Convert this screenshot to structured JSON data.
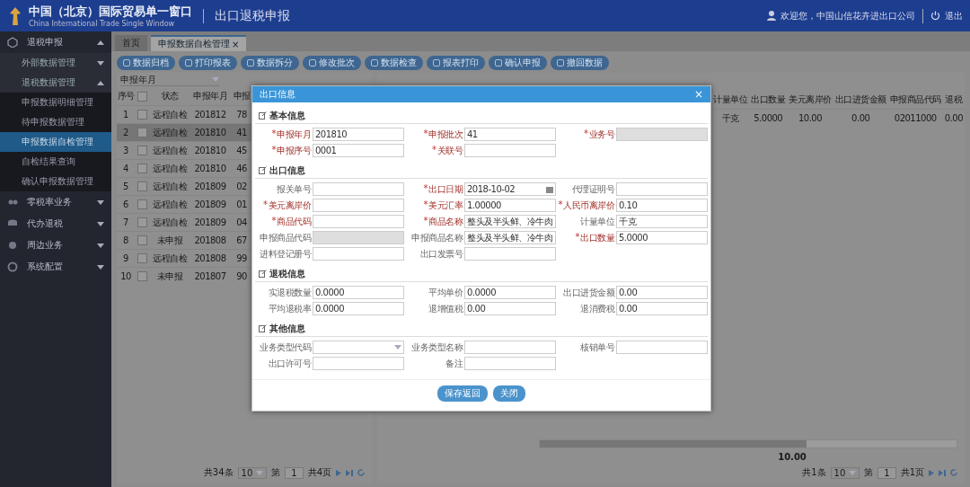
{
  "header": {
    "title": "中国（北京）国际贸易单一窗口",
    "subtitle": "China International Trade Single Window",
    "module": "出口退税申报",
    "welcome": "欢迎您，中国山信花卉进出口公司",
    "logout": "退出"
  },
  "sidebar": {
    "items": [
      {
        "label": "退税申报",
        "expanded": true,
        "children": [
          {
            "label": "外部数据管理",
            "expanded": false
          },
          {
            "label": "退税数据管理",
            "expanded": true,
            "children": [
              {
                "label": "申报数据明细管理",
                "selected": false
              },
              {
                "label": "待申报数据管理",
                "selected": false
              },
              {
                "label": "申报数据自检管理",
                "selected": true
              },
              {
                "label": "自检结果查询",
                "selected": false
              },
              {
                "label": "确认申报数据管理",
                "selected": false
              }
            ]
          }
        ]
      },
      {
        "label": "零税率业务",
        "expanded": false
      },
      {
        "label": "代办退税",
        "expanded": false
      },
      {
        "label": "周边业务",
        "expanded": false
      },
      {
        "label": "系统配置",
        "expanded": false
      }
    ]
  },
  "tabs": [
    {
      "label": "首页",
      "selected": false
    },
    {
      "label": "申报数据自检管理",
      "selected": true,
      "close": "×"
    }
  ],
  "toolbar": [
    "数据归档",
    "打印报表",
    "数据拆分",
    "修改批次",
    "数据检查",
    "报表打印",
    "确认申报",
    "撤回数据"
  ],
  "filter": {
    "placeholder": "申报年月"
  },
  "left_table": {
    "columns": [
      "序号",
      "状态",
      "申报年月",
      "申报"
    ],
    "header_checked": false,
    "rows": [
      {
        "index": "1",
        "checked": false,
        "selected": false,
        "status": "远程自检",
        "year_month": "201812",
        "batch": "78"
      },
      {
        "index": "2",
        "checked": false,
        "selected": true,
        "status": "远程自检",
        "year_month": "201810",
        "batch": "41"
      },
      {
        "index": "3",
        "checked": false,
        "selected": false,
        "status": "远程自检",
        "year_month": "201810",
        "batch": "45"
      },
      {
        "index": "4",
        "checked": false,
        "selected": false,
        "status": "远程自检",
        "year_month": "201810",
        "batch": "46"
      },
      {
        "index": "5",
        "checked": false,
        "selected": false,
        "status": "远程自检",
        "year_month": "201809",
        "batch": "02"
      },
      {
        "index": "6",
        "checked": false,
        "selected": false,
        "status": "远程自检",
        "year_month": "201809",
        "batch": "01"
      },
      {
        "index": "7",
        "checked": false,
        "selected": false,
        "status": "远程自检",
        "year_month": "201809",
        "batch": "04"
      },
      {
        "index": "8",
        "checked": false,
        "selected": false,
        "status": "未申报",
        "year_month": "201808",
        "batch": "67"
      },
      {
        "index": "9",
        "checked": false,
        "selected": false,
        "status": "远程自检",
        "year_month": "201808",
        "batch": "99"
      },
      {
        "index": "10",
        "checked": false,
        "selected": false,
        "status": "未申报",
        "year_month": "201807",
        "batch": "90"
      }
    ]
  },
  "right_table": {
    "columns": [
      "计量单位",
      "出口数量",
      "美元离岸价",
      "出口进货金额",
      "申报商品代码",
      "退税"
    ],
    "rows": [
      {
        "cells": [
          "千克",
          "5.0000",
          "10.00",
          "0.00",
          "02011000",
          "0.00"
        ]
      }
    ],
    "total": "10.00"
  },
  "left_pagination": {
    "total": "共34条",
    "page_size": "10",
    "page_label": "第",
    "page": "1",
    "pages": "共4页"
  },
  "right_pagination": {
    "total": "共1条",
    "page_size": "10",
    "page_label": "第",
    "page": "1",
    "pages": "共1页"
  },
  "dialog": {
    "title": "出口信息",
    "close": "×",
    "sections": [
      {
        "title": "基本信息",
        "rows": [
          [
            {
              "label": "申报年月",
              "mark": "*",
              "value": "201810"
            },
            {
              "label": "申报批次",
              "mark": "*",
              "value": "41"
            },
            {
              "label": "业务号",
              "mark": "*",
              "disabled": true
            }
          ],
          [
            {
              "label": "申报序号",
              "mark": "*",
              "value": "0001"
            },
            {
              "label": "关联号",
              "mark": "*"
            }
          ]
        ]
      },
      {
        "title": "出口信息",
        "rows": [
          [
            {
              "label": "报关单号"
            },
            {
              "label": "出口日期",
              "mark": "*",
              "value": "2018-10-02",
              "kind": "date"
            },
            {
              "label": "代理证明号"
            }
          ],
          [
            {
              "label": "美元离岸价",
              "mark": "*"
            },
            {
              "label": "美元汇率",
              "mark": "*",
              "value": "1.00000"
            },
            {
              "label": "人民币离岸价",
              "mark": "*",
              "value": "0.10"
            }
          ],
          [
            {
              "label": "商品代码",
              "mark": "*"
            },
            {
              "label": "商品名称",
              "mark": "*",
              "value": "整头及半头鲜、冷牛肉"
            },
            {
              "label": "计量单位",
              "value": "千克"
            }
          ],
          [
            {
              "label": "申报商品代码",
              "disabled": true
            },
            {
              "label": "申报商品名称",
              "value": "整头及半头鲜、冷牛肉"
            },
            {
              "label": "出口数量",
              "mark": "*",
              "value": "5.0000"
            }
          ],
          [
            {
              "label": "进料登记册号"
            },
            {
              "label": "出口发票号"
            }
          ]
        ]
      },
      {
        "title": "退税信息",
        "rows": [
          [
            {
              "label": "实退税数量",
              "value": "0.0000"
            },
            {
              "label": "平均单价",
              "value": "0.0000"
            },
            {
              "label": "出口进货金额",
              "value": "0.00"
            }
          ],
          [
            {
              "label": "平均退税率",
              "value": "0.0000"
            },
            {
              "label": "退增值税",
              "value": "0.00"
            },
            {
              "label": "退消费税",
              "value": "0.00"
            }
          ]
        ]
      },
      {
        "title": "其他信息",
        "rows": [
          [
            {
              "label": "业务类型代码",
              "kind": "select"
            },
            {
              "label": "业务类型名称"
            },
            {
              "label": "核销单号"
            }
          ],
          [
            {
              "label": "出口许可号"
            },
            {
              "label": "备注"
            }
          ]
        ]
      }
    ],
    "buttons": [
      "保存返回",
      "关闭"
    ]
  }
}
